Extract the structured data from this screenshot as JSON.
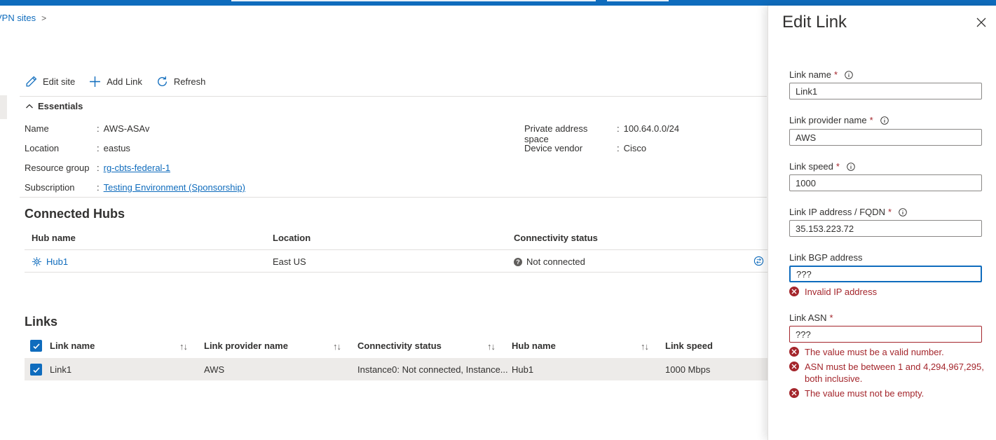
{
  "breadcrumb": {
    "item": "VPN sites",
    "chevron": ">"
  },
  "toolbar": {
    "edit_site": "Edit site",
    "add_link": "Add Link",
    "refresh": "Refresh"
  },
  "essentials": {
    "title": "Essentials",
    "name_label": "Name",
    "name_value": "AWS-ASAv",
    "location_label": "Location",
    "location_value": "eastus",
    "rg_label": "Resource group",
    "rg_value": "rg-cbts-federal-1",
    "sub_label": "Subscription",
    "sub_value": "Testing Environment (Sponsorship)",
    "pas_label": "Private address space",
    "pas_value": "100.64.0.0/24",
    "vendor_label": "Device vendor",
    "vendor_value": "Cisco",
    "colon": ":"
  },
  "hubs": {
    "title": "Connected Hubs",
    "headers": [
      "Hub name",
      "Location",
      "Connectivity status"
    ],
    "rows": [
      {
        "name": "Hub1",
        "location": "East US",
        "status": "Not connected"
      }
    ]
  },
  "links": {
    "title": "Links",
    "headers": [
      "Link name",
      "Link provider name",
      "Connectivity status",
      "Hub name",
      "Link speed"
    ],
    "sort_glyph": "↑↓",
    "rows": [
      {
        "name": "Link1",
        "provider": "AWS",
        "status": "Instance0: Not connected, Instance...",
        "hub": "Hub1",
        "speed": "1000 Mbps"
      }
    ]
  },
  "panel": {
    "title": "Edit Link",
    "required_mark": "*",
    "fields": {
      "link_name": {
        "label": "Link name",
        "value": "Link1"
      },
      "provider": {
        "label": "Link provider name",
        "value": "AWS"
      },
      "speed": {
        "label": "Link speed",
        "value": "1000"
      },
      "ip": {
        "label": "Link IP address / FQDN",
        "value": "35.153.223.72"
      },
      "bgp": {
        "label": "Link BGP address",
        "value": "???",
        "error": "Invalid IP address"
      },
      "asn": {
        "label": "Link ASN",
        "value": "???",
        "errors": [
          "The value must be a valid number.",
          "ASN must be between 1 and 4,294,967,295, both inclusive.",
          "The value must not be empty."
        ]
      }
    }
  },
  "colors": {
    "accent": "#0f6cbd",
    "error": "#a4262c",
    "text": "#323130",
    "border": "#8a8886"
  }
}
